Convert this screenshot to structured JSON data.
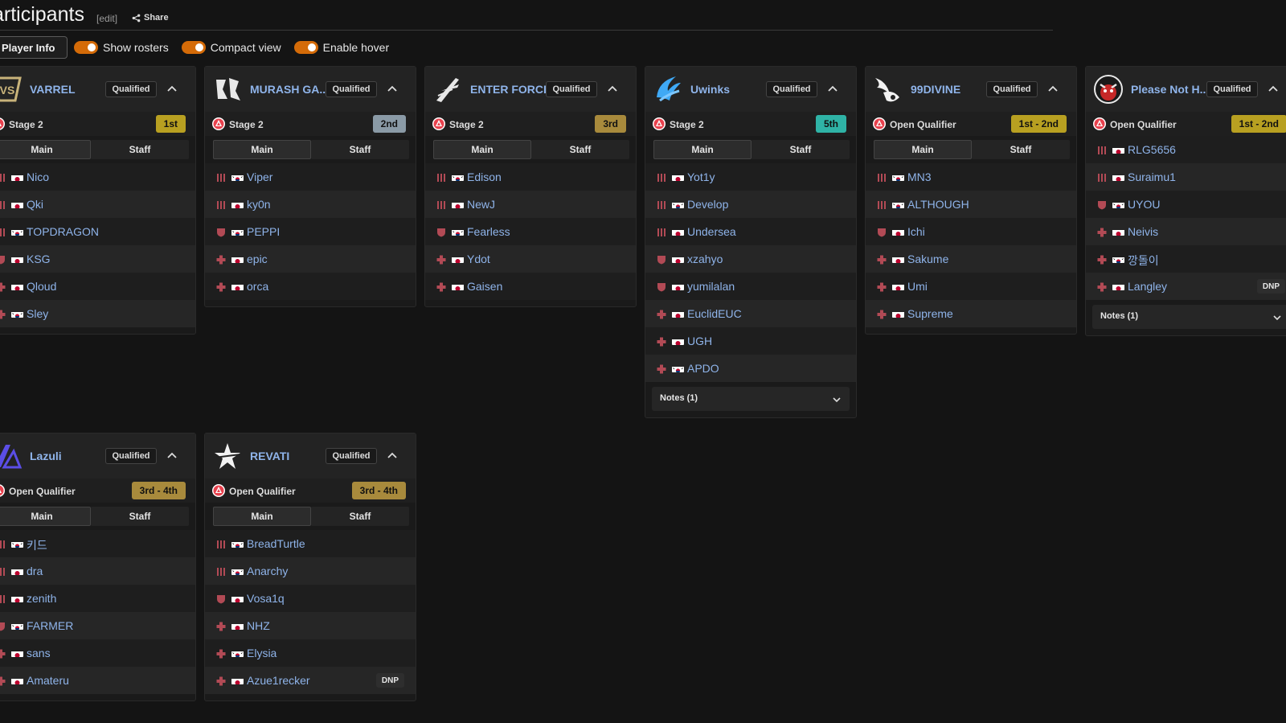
{
  "page": {
    "title": "articipants",
    "edit_label": "edit",
    "share_label": "Share"
  },
  "toolbar": {
    "player_info_label": "Player Info",
    "toggles": [
      {
        "label": "Show rosters",
        "on": true
      },
      {
        "label": "Compact view",
        "on": true
      },
      {
        "label": "Enable hover",
        "on": true
      }
    ]
  },
  "colors": {
    "accent_orange": "#d46b08",
    "team_name_blue": "#8fb4ea",
    "gold_badge": "#b8a021",
    "silver_badge": "#8a9aa6",
    "bronze_badge": "#a88a3c",
    "teal_badge": "#2fb3a6",
    "role_red": "#b24a55"
  },
  "teams": [
    {
      "name": "VARREL",
      "logo": "varrel-logo",
      "status": "Qualified",
      "stage": "Stage 2",
      "placement": "1st",
      "placement_color": "#b8a021",
      "tabs": [
        "Main",
        "Staff"
      ],
      "players": [
        {
          "name": "Nico",
          "role": "tank",
          "flag": "jp"
        },
        {
          "name": "Qki",
          "role": "tank",
          "flag": "jp"
        },
        {
          "name": "TOPDRAGON",
          "role": "tank",
          "flag": "kr"
        },
        {
          "name": "KSG",
          "role": "dps",
          "flag": "jp"
        },
        {
          "name": "Qloud",
          "role": "support",
          "flag": "jp"
        },
        {
          "name": "Sley",
          "role": "support",
          "flag": "kr"
        }
      ]
    },
    {
      "name": "MURASH GA...",
      "logo": "murash-logo",
      "status": "Qualified",
      "stage": "Stage 2",
      "placement": "2nd",
      "placement_color": "#8a9aa6",
      "tabs": [
        "Main",
        "Staff"
      ],
      "players": [
        {
          "name": "Viper",
          "role": "tank",
          "flag": "kr"
        },
        {
          "name": "ky0n",
          "role": "tank",
          "flag": "jp"
        },
        {
          "name": "PEPPI",
          "role": "dps",
          "flag": "kr"
        },
        {
          "name": "epic",
          "role": "support",
          "flag": "jp"
        },
        {
          "name": "orca",
          "role": "support",
          "flag": "jp"
        }
      ]
    },
    {
      "name": "ENTER FORCE...",
      "logo": "enterforce-logo",
      "status": "Qualified",
      "stage": "Stage 2",
      "placement": "3rd",
      "placement_color": "#a88a3c",
      "tabs": [
        "Main",
        "Staff"
      ],
      "players": [
        {
          "name": "Edison",
          "role": "tank",
          "flag": "kr"
        },
        {
          "name": "NewJ",
          "role": "tank",
          "flag": "jp"
        },
        {
          "name": "Fearless",
          "role": "dps",
          "flag": "kr"
        },
        {
          "name": "Ydot",
          "role": "support",
          "flag": "jp"
        },
        {
          "name": "Gaisen",
          "role": "support",
          "flag": "jp"
        }
      ]
    },
    {
      "name": "Uwinks",
      "logo": "uwinks-logo",
      "status": "Qualified",
      "stage": "Stage 2",
      "placement": "5th",
      "placement_color": "#2fb3a6",
      "tabs": [
        "Main",
        "Staff"
      ],
      "players": [
        {
          "name": "Yot1y",
          "role": "tank",
          "flag": "jp"
        },
        {
          "name": "Develop",
          "role": "tank",
          "flag": "kr"
        },
        {
          "name": "Undersea",
          "role": "tank",
          "flag": "jp"
        },
        {
          "name": "xzahyo",
          "role": "dps",
          "flag": "jp"
        },
        {
          "name": "yumilalan",
          "role": "dps",
          "flag": "jp"
        },
        {
          "name": "EuclidEUC",
          "role": "support",
          "flag": "jp"
        },
        {
          "name": "UGH",
          "role": "support",
          "flag": "jp"
        },
        {
          "name": "APDO",
          "role": "support",
          "flag": "kr"
        }
      ],
      "notes": "Notes (1)"
    },
    {
      "name": "99DIVINE",
      "logo": "99divine-logo",
      "status": "Qualified",
      "stage": "Open Qualifier",
      "placement": "1st - 2nd",
      "placement_color": "#b8a021",
      "tabs": [
        "Main",
        "Staff"
      ],
      "players": [
        {
          "name": "MN3",
          "role": "tank",
          "flag": "kr"
        },
        {
          "name": "ALTHOUGH",
          "role": "tank",
          "flag": "kr"
        },
        {
          "name": "Ichi",
          "role": "dps",
          "flag": "jp"
        },
        {
          "name": "Sakume",
          "role": "support",
          "flag": "jp"
        },
        {
          "name": "Umi",
          "role": "support",
          "flag": "jp"
        },
        {
          "name": "Supreme",
          "role": "support",
          "flag": "jp"
        }
      ]
    },
    {
      "name": "Please Not H...",
      "logo": "pleasenot-logo",
      "status": "Qualified",
      "stage": "Open Qualifier",
      "placement": "1st - 2nd",
      "placement_color": "#b8a021",
      "tabs": [],
      "players": [
        {
          "name": "RLG5656",
          "role": "tank",
          "flag": "jp"
        },
        {
          "name": "Suraimu1",
          "role": "tank",
          "flag": "jp"
        },
        {
          "name": "UYOU",
          "role": "dps",
          "flag": "kr"
        },
        {
          "name": "Neivis",
          "role": "support",
          "flag": "jp"
        },
        {
          "name": "깡돌이",
          "role": "support",
          "flag": "kr"
        },
        {
          "name": "Langley",
          "role": "support",
          "flag": "jp",
          "dnp": "DNP"
        }
      ],
      "notes": "Notes (1)"
    },
    {
      "name": "Lazuli",
      "logo": "lazuli-logo",
      "status": "Qualified",
      "stage": "Open Qualifier",
      "placement": "3rd - 4th",
      "placement_color": "#a88a3c",
      "tabs": [
        "Main",
        "Staff"
      ],
      "players": [
        {
          "name": "키드",
          "role": "tank",
          "flag": "kr"
        },
        {
          "name": "dra",
          "role": "tank",
          "flag": "jp"
        },
        {
          "name": "zenith",
          "role": "tank",
          "flag": "jp"
        },
        {
          "name": "FARMER",
          "role": "dps",
          "flag": "kr"
        },
        {
          "name": "sans",
          "role": "support",
          "flag": "jp"
        },
        {
          "name": "Amateru",
          "role": "support",
          "flag": "jp"
        }
      ]
    },
    {
      "name": "REVATI",
      "logo": "revati-logo",
      "status": "Qualified",
      "stage": "Open Qualifier",
      "placement": "3rd - 4th",
      "placement_color": "#a88a3c",
      "tabs": [
        "Main",
        "Staff"
      ],
      "players": [
        {
          "name": "BreadTurtle",
          "role": "tank",
          "flag": "kr"
        },
        {
          "name": "Anarchy",
          "role": "tank",
          "flag": "kr"
        },
        {
          "name": "Vosa1q",
          "role": "dps",
          "flag": "jp"
        },
        {
          "name": "NHZ",
          "role": "support",
          "flag": "jp"
        },
        {
          "name": "Elysia",
          "role": "support",
          "flag": "kr"
        },
        {
          "name": "Azue1recker",
          "role": "support",
          "flag": "jp",
          "dnp": "DNP"
        }
      ]
    }
  ]
}
